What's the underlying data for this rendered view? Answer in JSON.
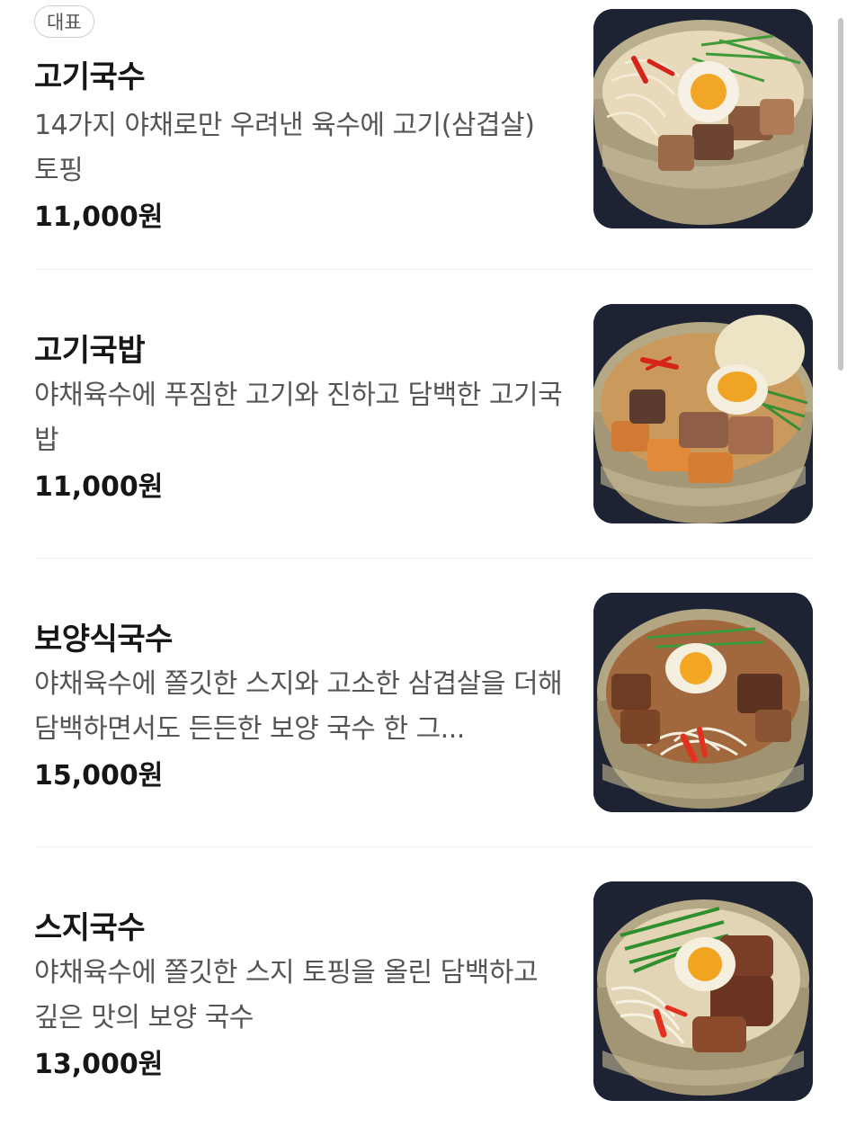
{
  "menu": {
    "items": [
      {
        "badge": "대표",
        "name": "고기국수",
        "description": "14가지 야채로만 우려낸 육수에 고기(삼겹살) 토핑",
        "price": "11,000원",
        "image_icon": "noodle-bowl-image"
      },
      {
        "name": "고기국밥",
        "description": "야채육수에 푸짐한 고기와 진하고 담백한 고기국밥",
        "price": "11,000원",
        "image_icon": "rice-soup-bowl-image"
      },
      {
        "name": "보양식국수",
        "description": "야채육수에 쫄깃한 스지와 고소한 삼겹살을 더해 담백하면서도 든든한 보양 국수 한 그...",
        "price": "15,000원",
        "image_icon": "noodle-bowl-image"
      },
      {
        "name": "스지국수",
        "description": "야채육수에 쫄깃한 스지 토핑을 올린 담백하고 깊은 맛의 보양 국수",
        "price": "13,000원",
        "image_icon": "noodle-bowl-image"
      }
    ]
  },
  "colors": {
    "background": "#ffffff",
    "title": "#161616",
    "description": "#555555",
    "divider": "#efefef",
    "badge_border": "#cfcfcf"
  }
}
